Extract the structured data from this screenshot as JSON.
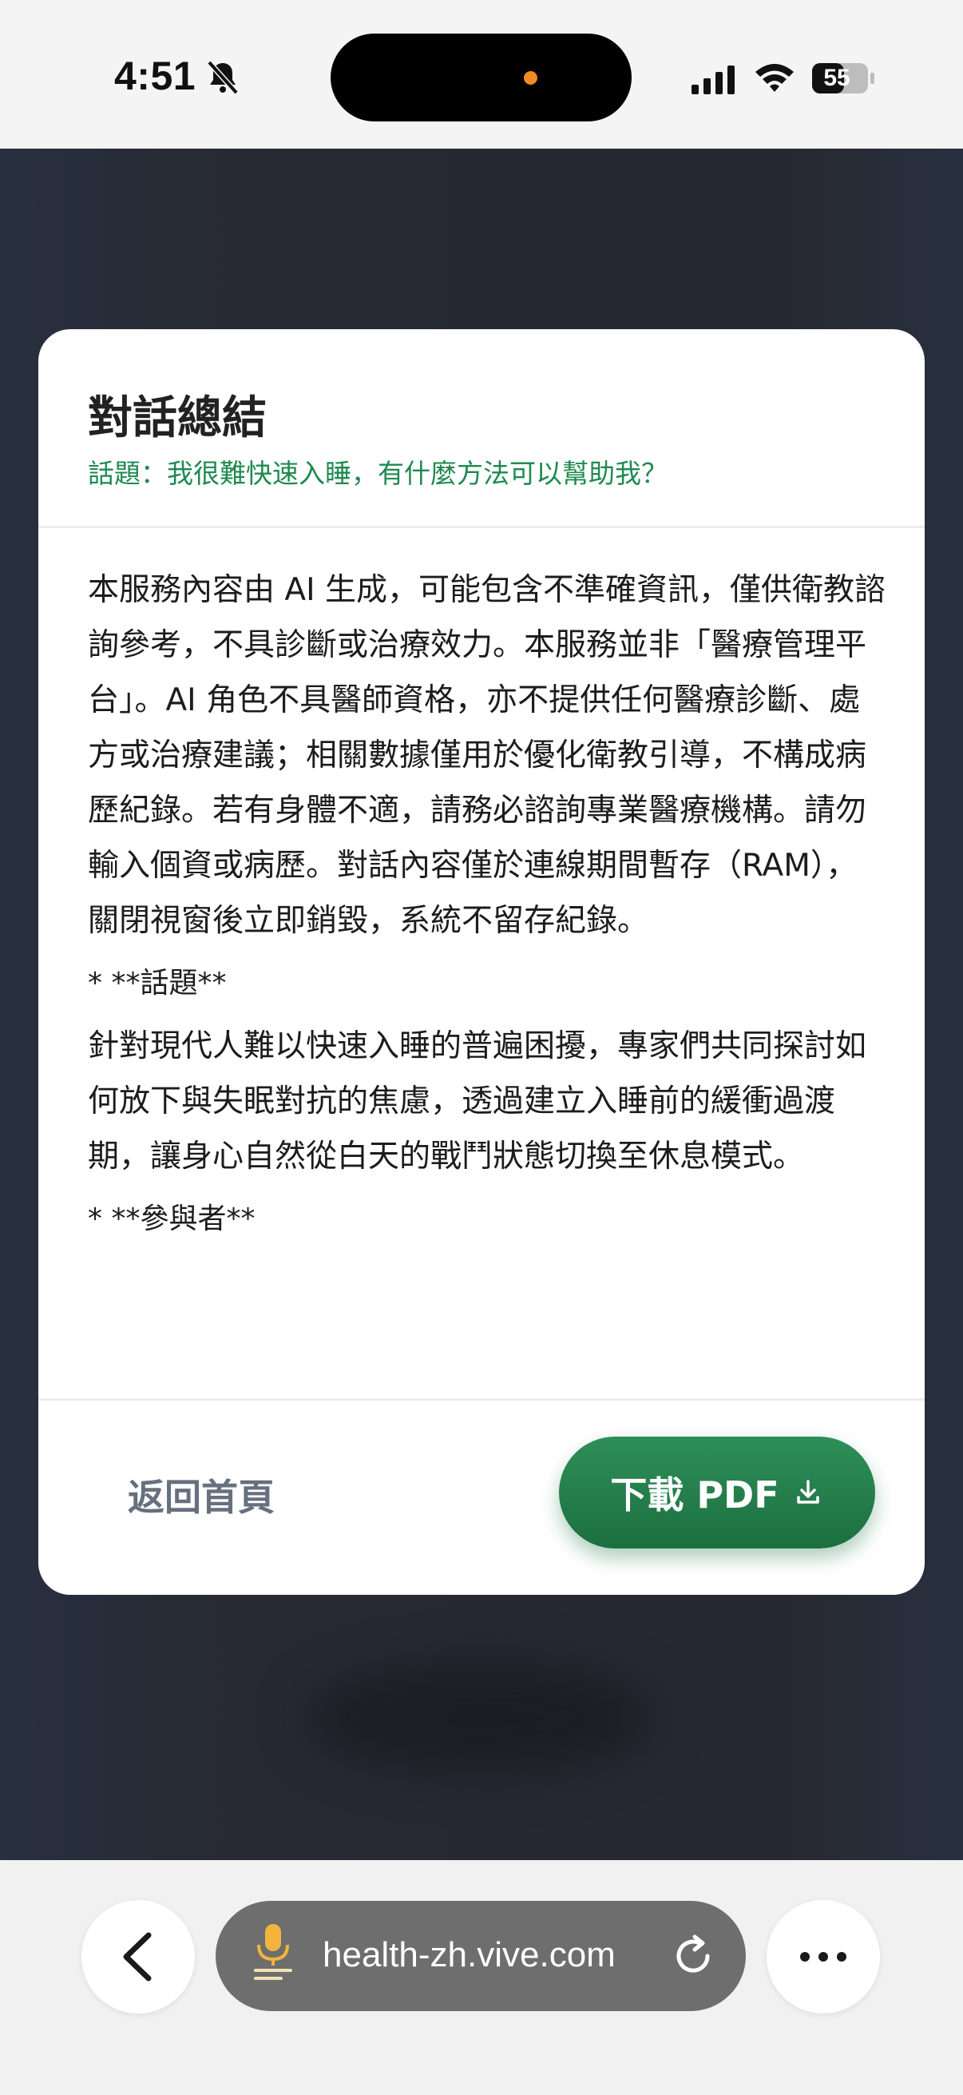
{
  "status_bar": {
    "time": "4:51",
    "battery": "55"
  },
  "modal": {
    "title": "對話總結",
    "topic": "話題：我很難快速入睡，有什麼方法可以幫助我？",
    "disclaimer": "本服務內容由 AI 生成，可能包含不準確資訊，僅供衛教諮詢參考，不具診斷或治療效力。本服務並非「醫療管理平台」。AI 角色不具醫師資格，亦不提供任何醫療診斷、處方或治療建議；相關數據僅用於優化衛教引導，不構成病歷紀錄。若有身體不適，請務必諮詢專業醫療機構。請勿輸入個資或病歷。對話內容僅於連線期間暫存（RAM），關閉視窗後立即銷毀，系統不留存紀錄。",
    "section_topic_heading": "* **話題**",
    "section_topic_text": "針對現代人難以快速入睡的普遍困擾，專家們共同探討如何放下與失眠對抗的焦慮，透過建立入睡前的緩衝過渡期，讓身心自然從白天的戰鬥狀態切換至休息模式。",
    "section_participants_heading": "* **參與者**",
    "home_button": "返回首頁",
    "pdf_button": "下載 PDF"
  },
  "browser": {
    "url": "health-zh.vive.com"
  }
}
